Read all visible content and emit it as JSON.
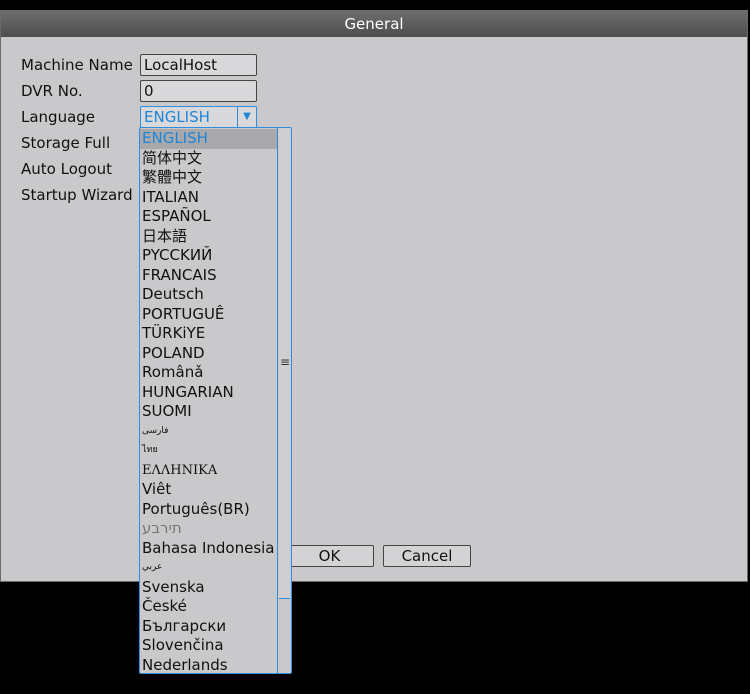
{
  "window": {
    "title": "General"
  },
  "fields": {
    "machine_name": {
      "label": "Machine Name",
      "value": "LocalHost"
    },
    "dvr_no": {
      "label": "DVR No.",
      "value": "0"
    },
    "language": {
      "label": "Language",
      "value": "ENGLISH"
    },
    "storage_full": {
      "label": "Storage Full"
    },
    "auto_logout": {
      "label": "Auto Logout"
    },
    "startup_wizard": {
      "label": "Startup Wizard"
    }
  },
  "buttons": {
    "ok": "OK",
    "cancel": "Cancel"
  },
  "language_options": [
    "ENGLISH",
    "简体中文",
    "繁體中文",
    "ITALIAN",
    "ESPAÑOL",
    "日本語",
    "PYCCKИЙ",
    "FRANCAIS",
    "Deutsch",
    "PORTUGUÊ",
    "TÜRKiYE",
    "POLAND",
    "Românǎ",
    "HUNGARIAN",
    "SUOMI",
    "فارسی",
    "ไทย",
    "ΕΛΛΗΝΙΚΑ",
    "Viêt",
    "Português(BR)",
    "תירבע",
    "Bahasa Indonesia",
    "عربي",
    "Svenska",
    "České",
    "Български",
    "Slovenčina",
    "Nederlands"
  ],
  "icons": {
    "dropdown_arrow": "▼",
    "scroll_grip": "≡"
  },
  "colors": {
    "accent": "#1d86d8",
    "background": "#c9c9cb",
    "titlebar": "#5a5a5a"
  }
}
